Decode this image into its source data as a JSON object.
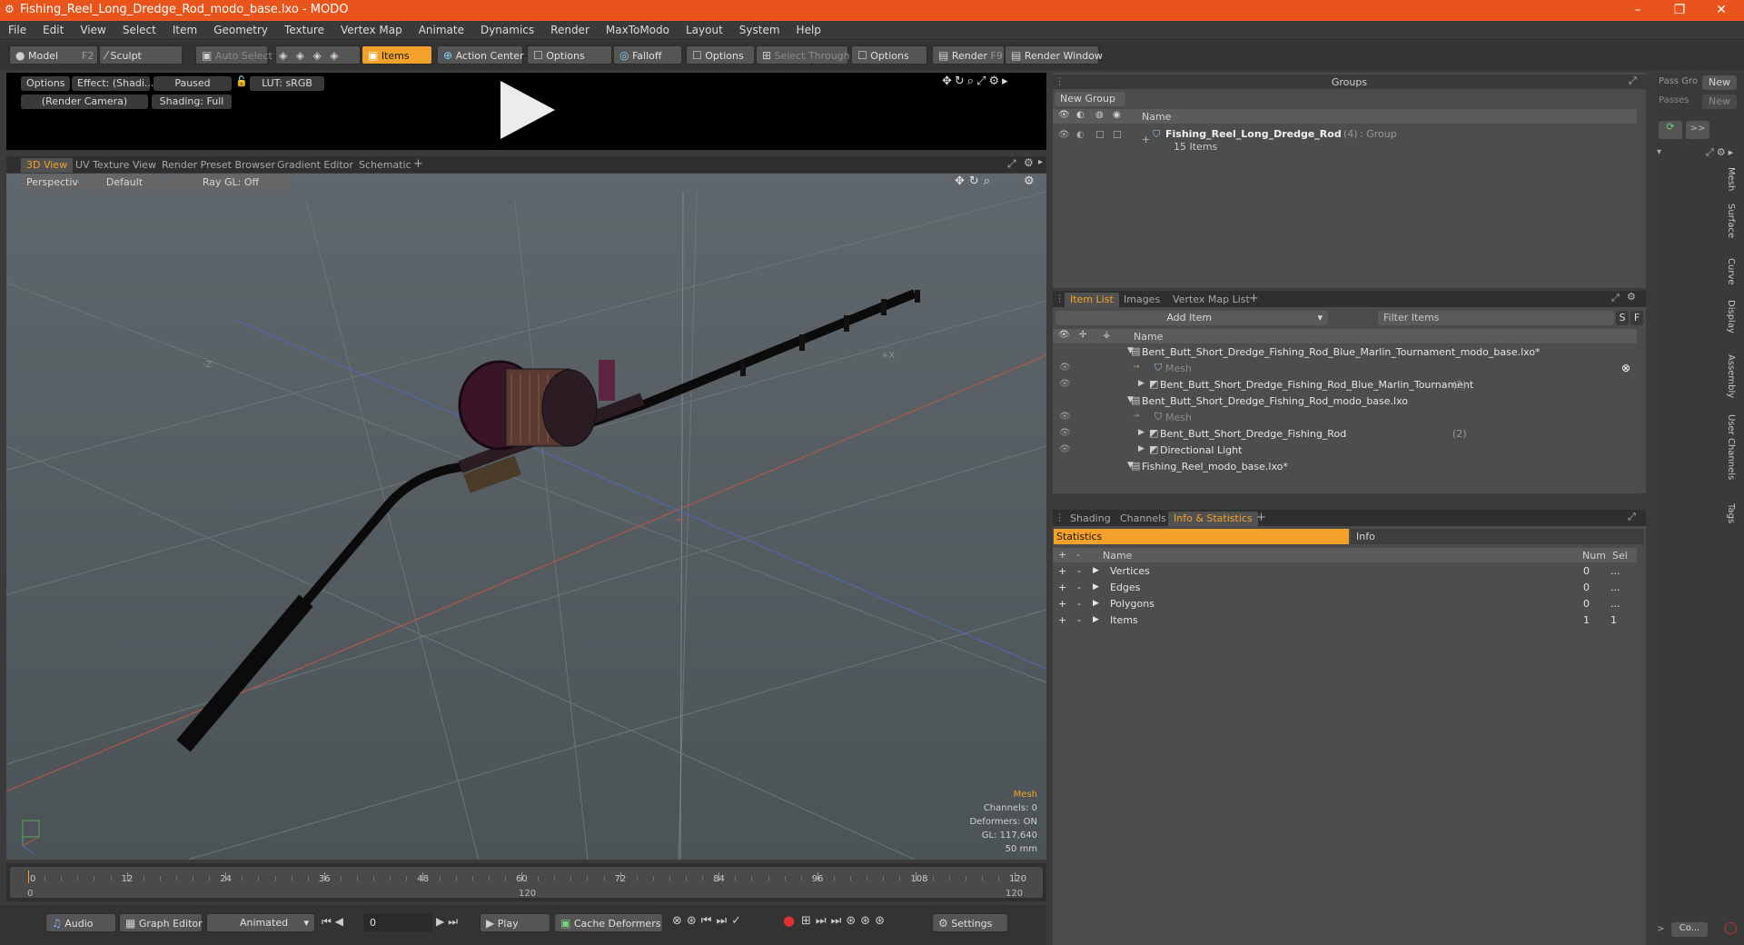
{
  "window": {
    "title": "Fishing_Reel_Long_Dredge_Rod_modo_base.lxo - MODO"
  },
  "menu": [
    "File",
    "Edit",
    "View",
    "Select",
    "Item",
    "Geometry",
    "Texture",
    "Vertex Map",
    "Animate",
    "Dynamics",
    "Render",
    "MaxToModo",
    "Layout",
    "System",
    "Help"
  ],
  "toolbar": {
    "model": "Model",
    "model_key": "F2",
    "sculpt": "Sculpt",
    "auto_select": "Auto Select",
    "items": "Items",
    "action_center": "Action Center",
    "options1": "Options",
    "falloff": "Falloff",
    "options2": "Options",
    "select_through": "Select Through",
    "options3": "Options",
    "render": "Render",
    "render_key": "F9",
    "render_window": "Render Window"
  },
  "preview": {
    "options": "Options",
    "effect": "Effect: (Shadi...",
    "paused": "Paused",
    "lut": "LUT: sRGB",
    "camera": "(Render Camera)",
    "shading": "Shading: Full"
  },
  "viewtabs": [
    "3D View",
    "UV Texture View",
    "Render Preset Browser",
    "Gradient Editor",
    "Schematic"
  ],
  "viewport": {
    "mode": "Perspective",
    "style": "Default",
    "raygl": "Ray GL: Off",
    "axis_z": "-Z",
    "axis_x": "+X"
  },
  "mesh_info": {
    "title": "Mesh",
    "channels": "Channels: 0",
    "deformers": "Deformers: ON",
    "gl": "GL: 117,640",
    "lens": "50 mm"
  },
  "timeline": {
    "ticks": [
      "0",
      "12",
      "24",
      "36",
      "48",
      "60",
      "72",
      "84",
      "96",
      "108",
      "120"
    ],
    "start": "0",
    "mid": "120",
    "end": "120"
  },
  "bottombar": {
    "audio": "Audio",
    "graph_editor": "Graph Editor",
    "animated": "Animated",
    "frame": "0",
    "play": "Play",
    "cache": "Cache Deformers",
    "settings": "Settings"
  },
  "groups": {
    "title": "Groups",
    "new_group": "New Group",
    "col_name": "Name",
    "group_name": "Fishing_Reel_Long_Dredge_Rod",
    "group_count": "(4)",
    "group_type": ": Group",
    "group_items": "15 Items"
  },
  "passes": {
    "pass_gro": "Pass Gro",
    "passes": "Passes",
    "new1": "New",
    "new2": "New"
  },
  "itemtabs": [
    "Item List",
    "Images",
    "Vertex Map List"
  ],
  "itemlist": {
    "add_item": "Add Item",
    "filter": "Filter Items",
    "s": "S",
    "f": "F",
    "col_name": "Name",
    "rows": [
      {
        "label": "Bent_Butt_Short_Dredge_Fishing_Rod_Blue_Marlin_Tournament_modo_base.lxo*",
        "count": "",
        "indent": 0,
        "dim": false
      },
      {
        "label": "Mesh",
        "count": "",
        "indent": 2,
        "dim": true
      },
      {
        "label": "Bent_Butt_Short_Dredge_Fishing_Rod_Blue_Marlin_Tournament",
        "count": "(2)",
        "indent": 1,
        "dim": false
      },
      {
        "label": "Bent_Butt_Short_Dredge_Fishing_Rod_modo_base.lxo",
        "count": "",
        "indent": 0,
        "dim": false
      },
      {
        "label": "Mesh",
        "count": "",
        "indent": 2,
        "dim": true
      },
      {
        "label": "Bent_Butt_Short_Dredge_Fishing_Rod",
        "count": "(2)",
        "indent": 1,
        "dim": false
      },
      {
        "label": "Directional Light",
        "count": "",
        "indent": 1,
        "dim": false
      },
      {
        "label": "Fishing_Reel_modo_base.lxo*",
        "count": "",
        "indent": 0,
        "dim": false
      }
    ]
  },
  "infotabs": [
    "Shading",
    "Channels",
    "Info & Statistics"
  ],
  "stats": {
    "tab_statistics": "Statistics",
    "tab_info": "Info",
    "col_name": "Name",
    "col_num": "Num",
    "col_sel": "Sel",
    "rows": [
      {
        "name": "Vertices",
        "num": "0",
        "sel": "..."
      },
      {
        "name": "Edges",
        "num": "0",
        "sel": "..."
      },
      {
        "name": "Polygons",
        "num": "0",
        "sel": "..."
      },
      {
        "name": "Items",
        "num": "1",
        "sel": "1"
      }
    ]
  },
  "sidetabs": [
    "Mesh",
    "Surface",
    "Curve",
    "Display",
    "Assembly",
    "User Channels",
    "Tags"
  ],
  "corner": {
    "co": "Co..."
  }
}
